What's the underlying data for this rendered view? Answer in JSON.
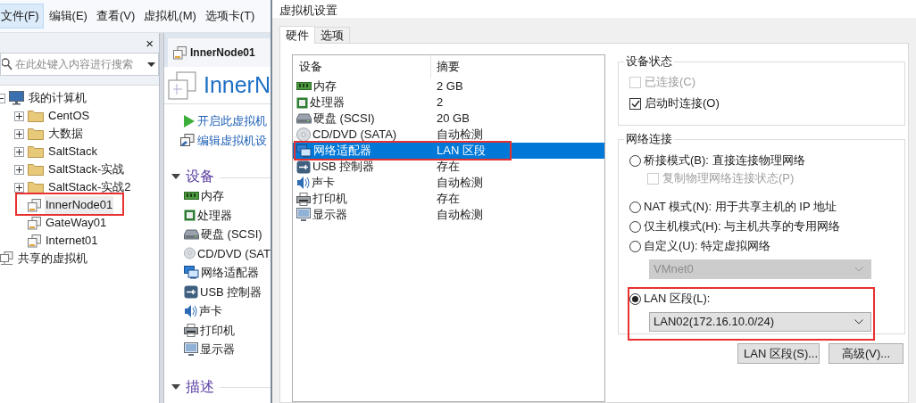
{
  "menu_bar": {
    "items": [
      {
        "label": "文件(F)",
        "selected": true
      },
      {
        "label": "编辑(E)",
        "selected": false
      },
      {
        "label": "查看(V)",
        "selected": false
      },
      {
        "label": "虚拟机(M)",
        "selected": false
      },
      {
        "label": "选项卡(T)",
        "selected": false
      }
    ]
  },
  "library": {
    "close": "×",
    "search": {
      "placeholder": "在此处键入内容进行搜索"
    },
    "tree": [
      {
        "label": "我的计算机",
        "kind": "computer",
        "expanded": true,
        "selected": false,
        "highlighted": false,
        "children": [
          {
            "label": "CentOS",
            "kind": "folder",
            "expanded": false,
            "selected": false,
            "highlighted": false
          },
          {
            "label": "大数据",
            "kind": "folder",
            "expanded": false,
            "selected": false,
            "highlighted": false
          },
          {
            "label": "SaltStack",
            "kind": "folder",
            "expanded": false,
            "selected": false,
            "highlighted": false
          },
          {
            "label": "SaltStack-实战",
            "kind": "folder",
            "expanded": false,
            "selected": false,
            "highlighted": false
          },
          {
            "label": "SaltStack-实战2",
            "kind": "folder",
            "expanded": false,
            "selected": false,
            "highlighted": false
          },
          {
            "label": "InnerNode01",
            "kind": "vm",
            "selected": true,
            "highlighted": true
          },
          {
            "label": "GateWay01",
            "kind": "vm",
            "selected": false,
            "highlighted": false
          },
          {
            "label": "Internet01",
            "kind": "vm",
            "selected": false,
            "highlighted": false
          }
        ]
      },
      {
        "label": "共享的虚拟机",
        "kind": "shared",
        "selected": false,
        "highlighted": false
      }
    ]
  },
  "vm_page": {
    "tab": "InnerNode01",
    "title": "InnerN",
    "actions": [
      {
        "label": "开启此虚拟机",
        "kind": "play"
      },
      {
        "label": "编辑虚拟机设",
        "kind": "edit"
      }
    ],
    "devices": {
      "title": "设备",
      "expanded": true,
      "items": [
        {
          "label": "内存",
          "kind": "memory"
        },
        {
          "label": "处理器",
          "kind": "cpu"
        },
        {
          "label": "硬盘 (SCSI)",
          "kind": "disk"
        },
        {
          "label": "CD/DVD (SAT",
          "kind": "cd"
        },
        {
          "label": "网络适配器",
          "kind": "network"
        },
        {
          "label": "USB 控制器",
          "kind": "usb"
        },
        {
          "label": "声卡",
          "kind": "sound"
        },
        {
          "label": "打印机",
          "kind": "printer"
        },
        {
          "label": "显示器",
          "kind": "display"
        }
      ]
    },
    "description": {
      "title": "描述",
      "expanded": true
    }
  },
  "dialog": {
    "title": "虚拟机设置",
    "tabs": [
      {
        "label": "硬件",
        "selected": true
      },
      {
        "label": "选项",
        "selected": false
      }
    ],
    "device_list": {
      "columns": [
        "设备",
        "摘要"
      ],
      "rows": [
        {
          "device": "内存",
          "summary": "2 GB",
          "kind": "memory",
          "selected": false,
          "highlighted": false
        },
        {
          "device": "处理器",
          "summary": "2",
          "kind": "cpu",
          "selected": false,
          "highlighted": false
        },
        {
          "device": "硬盘 (SCSI)",
          "summary": "20 GB",
          "kind": "disk",
          "selected": false,
          "highlighted": false
        },
        {
          "device": "CD/DVD (SATA)",
          "summary": "自动检测",
          "kind": "cd",
          "selected": false,
          "highlighted": false
        },
        {
          "device": "网络适配器",
          "summary": "LAN 区段",
          "kind": "network",
          "selected": true,
          "highlighted": true
        },
        {
          "device": "USB 控制器",
          "summary": "存在",
          "kind": "usb",
          "selected": false,
          "highlighted": false
        },
        {
          "device": "声卡",
          "summary": "自动检测",
          "kind": "sound",
          "selected": false,
          "highlighted": false
        },
        {
          "device": "打印机",
          "summary": "存在",
          "kind": "printer",
          "selected": false,
          "highlighted": false
        },
        {
          "device": "显示器",
          "summary": "自动检测",
          "kind": "display",
          "selected": false,
          "highlighted": false
        }
      ]
    },
    "device_status": {
      "title": "设备状态",
      "options": [
        {
          "label": "已连接(C)",
          "checked": false,
          "disabled": true
        },
        {
          "label": "启动时连接(O)",
          "checked": true,
          "disabled": false
        }
      ]
    },
    "network": {
      "title": "网络连接",
      "options": [
        {
          "label": "桥接模式(B): 直接连接物理网络",
          "selected": false,
          "highlighted": false,
          "sub": {
            "kind": "checkbox",
            "label": "复制物理网络连接状态(P)",
            "checked": false,
            "disabled": true
          }
        },
        {
          "label": "NAT 模式(N): 用于共享主机的 IP 地址",
          "selected": false,
          "highlighted": false
        },
        {
          "label": "仅主机模式(H): 与主机共享的专用网络",
          "selected": false,
          "highlighted": false
        },
        {
          "label": "自定义(U): 特定虚拟网络",
          "selected": false,
          "highlighted": false,
          "sub": {
            "kind": "select",
            "value": "VMnet0",
            "disabled": true
          }
        },
        {
          "label": "LAN 区段(L):",
          "selected": true,
          "highlighted": true,
          "sub": {
            "kind": "select",
            "value": "LAN02(172.16.10.0/24)",
            "disabled": false
          }
        }
      ]
    },
    "buttons": [
      "LAN 区段(S)...",
      "高级(V)..."
    ]
  }
}
